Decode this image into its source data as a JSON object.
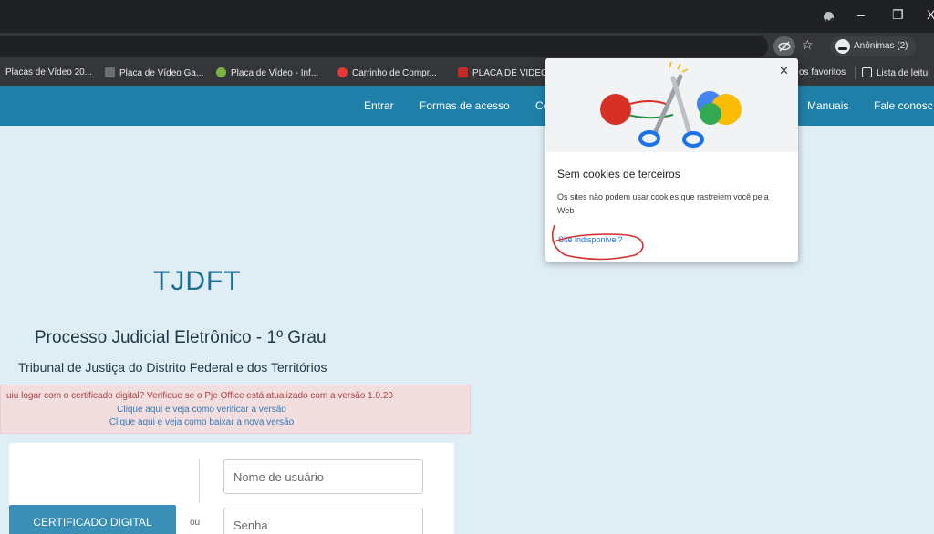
{
  "window": {
    "minimize": "–",
    "restore": "❐",
    "close": "X"
  },
  "toolbar": {
    "incognito_label": "Anônimas (2)",
    "icons": [
      "eye-off-icon",
      "star-icon",
      "incognito-icon"
    ]
  },
  "bookmarks": {
    "items": [
      {
        "label": "Placas de Vídeo 20...",
        "color": "#e8eaed"
      },
      {
        "label": "Placa de Vídeo Ga...",
        "color": "#3c4043"
      },
      {
        "label": "Placa de Vídeo - Inf...",
        "color": "#7cb342"
      },
      {
        "label": "Carrinho de Compr...",
        "color": "#e53935"
      },
      {
        "label": "PLACA DE VIDEO",
        "color": "#c62828"
      }
    ],
    "other_favorites": "os favoritos",
    "reading_list": "Lista de leitu"
  },
  "nav": {
    "entrar": "Entrar",
    "formas": "Formas de acesso",
    "partial": "Co",
    "manuais": "Manuais",
    "fale": "Fale conosc"
  },
  "page": {
    "logo": "TJDFT",
    "title": "Processo Judicial Eletrônico - 1º Grau",
    "subtitle": "Tribunal de Justiça do Distrito Federal e dos Territórios",
    "alert_warning": "uiu logar com o certificado digital? Verifique se o Pje Office está atualizado com a versão 1.0.20",
    "alert_link1": "Clique aqui e veja como verificar a versão",
    "alert_link2": "Clique aqui e veja como baixar a nova versão",
    "cert_button": "CERTIFICADO DIGITAL",
    "or": "ou",
    "username_placeholder": "Nome de usuário",
    "password_placeholder": "Senha"
  },
  "popup": {
    "close": "✕",
    "title": "Sem cookies de terceiros",
    "description": "Os sites não podem usar cookies que rastreiem você pela Web",
    "link": "Site indisponível?"
  },
  "colors": {
    "navbar": "#1e80a8",
    "background": "#dfeef4",
    "alert_text": "#a94442",
    "link": "#337ab7",
    "annotation": "#d32f2f"
  }
}
